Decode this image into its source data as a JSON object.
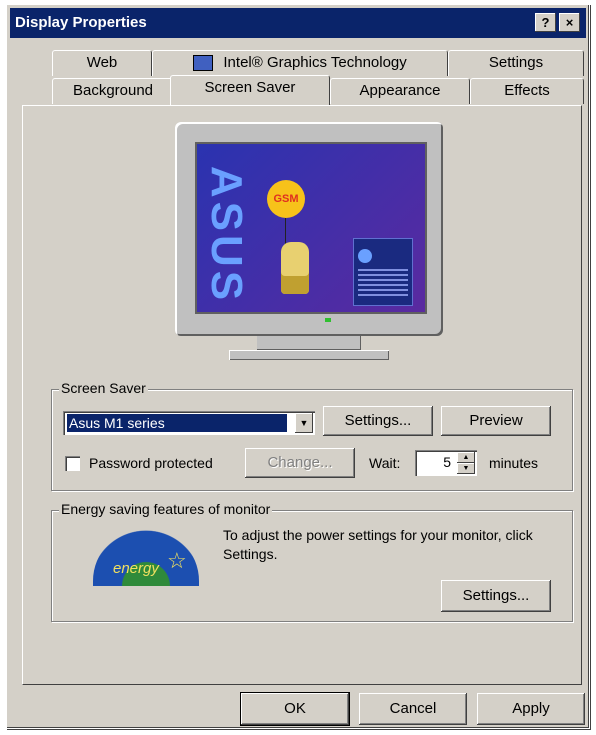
{
  "window": {
    "title": "Display Properties",
    "help_btn": "?",
    "close_btn": "×"
  },
  "tabs_back": [
    {
      "label": "Web"
    },
    {
      "label": "Intel® Graphics Technology"
    },
    {
      "label": "Settings"
    }
  ],
  "tabs_front": [
    {
      "label": "Background"
    },
    {
      "label": "Screen Saver",
      "active": true
    },
    {
      "label": "Appearance"
    },
    {
      "label": "Effects"
    }
  ],
  "preview": {
    "logo": "ASUS",
    "balloon": "GSM"
  },
  "screen_saver": {
    "group_label": "Screen Saver",
    "selected": "Asus M1 series",
    "settings_btn": "Settings...",
    "preview_btn": "Preview",
    "password_label": "Password protected",
    "password_checked": false,
    "change_btn": "Change...",
    "wait_label": "Wait:",
    "wait_value": "5",
    "wait_units": "minutes"
  },
  "energy": {
    "group_label": "Energy saving features of monitor",
    "description": "To adjust the power settings for your monitor, click Settings.",
    "logo_text": "energy",
    "settings_btn": "Settings..."
  },
  "footer": {
    "ok": "OK",
    "cancel": "Cancel",
    "apply": "Apply"
  }
}
